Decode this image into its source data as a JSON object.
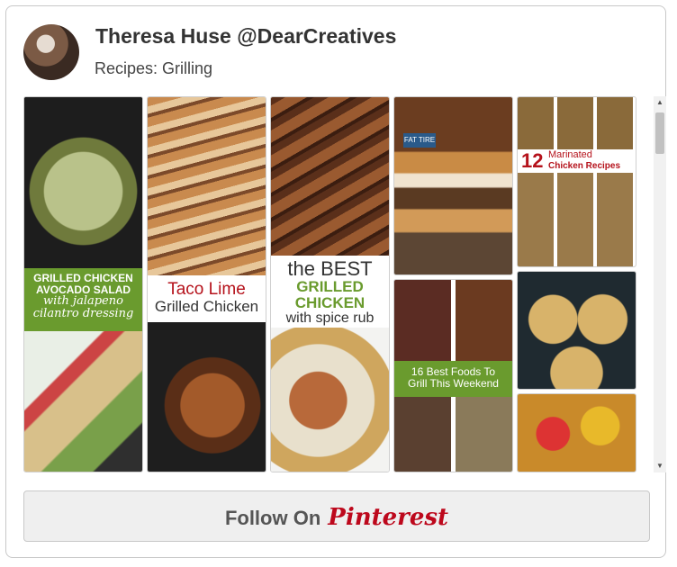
{
  "header": {
    "user_name": "Theresa Huse @DearCreatives",
    "board_name": "Recipes: Grilling"
  },
  "pins": {
    "p1": {
      "line1": "GRILLED CHICKEN",
      "line2": "AVOCADO SALAD",
      "line3": "with jalapeno",
      "line4": "cilantro dressing"
    },
    "p2": {
      "line1": "Taco Lime",
      "line2": "Grilled Chicken"
    },
    "p3": {
      "line1": "the BEST",
      "line2": "GRILLED CHICKEN",
      "line3": "with spice rub"
    },
    "p4": {
      "label": "FAT TIRE"
    },
    "p5": {
      "line1": "16 Best Foods To",
      "line2": "Grill This Weekend"
    },
    "p6": {
      "number": "12",
      "word1": "Marinated",
      "word2": "Chicken Recipes"
    }
  },
  "follow": {
    "prefix": "Follow On",
    "brand": "Pinterest"
  },
  "scrollbar": {
    "up": "▲",
    "down": "▼"
  },
  "colors": {
    "brand_red": "#bd081c",
    "caption_green": "#6a9b2e",
    "caption_red": "#b5121b"
  }
}
